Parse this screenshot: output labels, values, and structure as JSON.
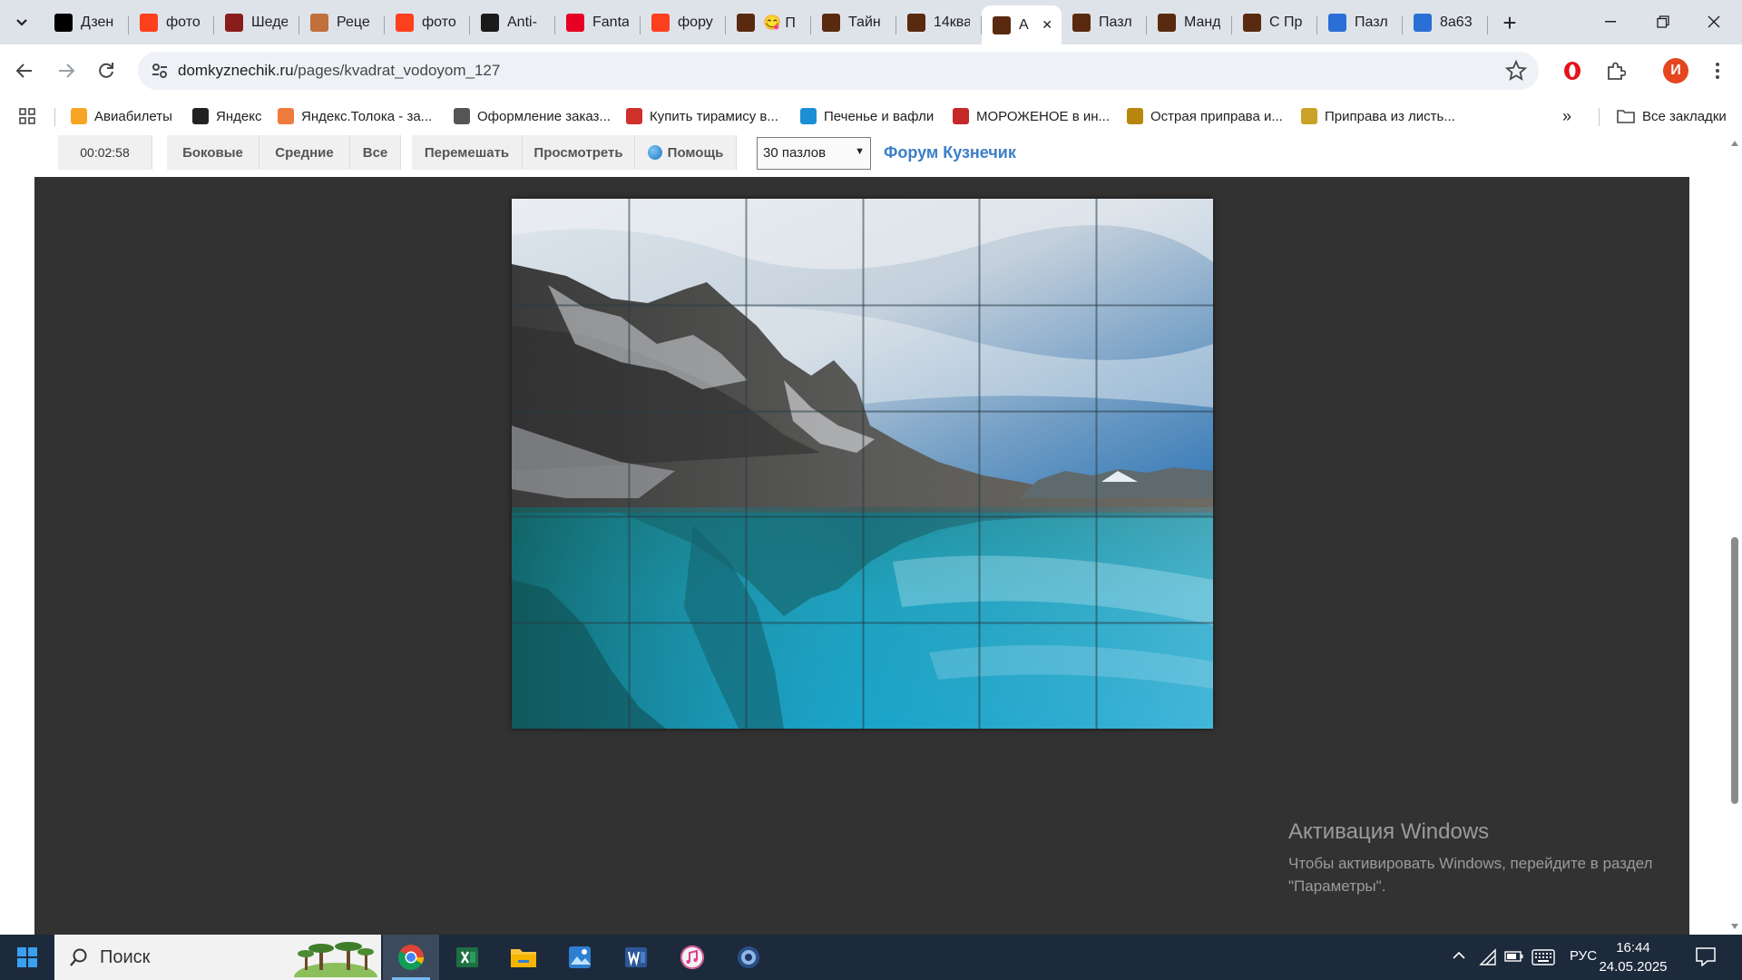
{
  "browser": {
    "tabs": [
      {
        "title": "Дзен",
        "icon": "dzen-icon",
        "color": "#000000"
      },
      {
        "title": "фото",
        "icon": "yandex-icon",
        "color": "#fc3f1d"
      },
      {
        "title": "Шеде",
        "icon": "site-icon",
        "color": "#8b1c1c"
      },
      {
        "title": "Реце",
        "icon": "recipe-icon",
        "color": "#c0703a"
      },
      {
        "title": "фото",
        "icon": "yandex-icon",
        "color": "#fc3f1d"
      },
      {
        "title": "Anti-",
        "icon": "anti-icon",
        "color": "#1a1a1a"
      },
      {
        "title": "Fanta",
        "icon": "pinterest-icon",
        "color": "#e60023"
      },
      {
        "title": "фору",
        "icon": "yandex-icon",
        "color": "#fc3f1d"
      },
      {
        "title": "😋 П",
        "icon": "puzzle-site-icon",
        "color": "#5a2a10"
      },
      {
        "title": "Тайн",
        "icon": "puzzle-site-icon",
        "color": "#5a2a10"
      },
      {
        "title": "14ква",
        "icon": "puzzle-site-icon",
        "color": "#5a2a10"
      },
      {
        "title": "А",
        "icon": "puzzle-site-icon",
        "color": "#5a2a10",
        "active": true
      },
      {
        "title": "Пазл",
        "icon": "puzzle-site-icon",
        "color": "#5a2a10"
      },
      {
        "title": "Манд",
        "icon": "puzzle-site-icon",
        "color": "#5a2a10"
      },
      {
        "title": "С Пр",
        "icon": "puzzle-site-icon",
        "color": "#5a2a10"
      },
      {
        "title": "Пазл",
        "icon": "puzzle-blue-icon",
        "color": "#2a6fd6"
      },
      {
        "title": "8a63",
        "icon": "puzzle-blue-icon",
        "color": "#2a6fd6"
      }
    ],
    "url": {
      "host": "domkyznechik.ru",
      "path": "/pages/kvadrat_vodoyom_127"
    },
    "profile_initial": "И",
    "bookmarks": [
      {
        "label": "Авиабилеты",
        "color": "#f5a623"
      },
      {
        "label": "Яндекс",
        "color": "#222222"
      },
      {
        "label": "Яндекс.Толока - за...",
        "color": "#f07b3f"
      },
      {
        "label": "Оформление заказ...",
        "color": "#555555"
      },
      {
        "label": "Купить тирамису в...",
        "color": "#d0302a"
      },
      {
        "label": "Печенье и вафли",
        "color": "#1b8fd6"
      },
      {
        "label": "МОРОЖЕНОЕ в ин...",
        "color": "#c62828"
      },
      {
        "label": "Острая приправа и...",
        "color": "#b8860b"
      },
      {
        "label": "Приправа из листь...",
        "color": "#c9a227"
      }
    ],
    "all_bookmarks": "Все закладки"
  },
  "puzzle": {
    "timer": "00:02:58",
    "buttons": {
      "sides": "Боковые",
      "middle": "Средние",
      "all": "Все",
      "shuffle": "Перемешать",
      "preview": "Просмотреть",
      "help": "Помощь"
    },
    "pieces_selected": "30 пазлов",
    "forum_link": "Форум Кузнечик",
    "grid_columns": 6,
    "grid_rows": 5
  },
  "windows": {
    "activation_title": "Активация Windows",
    "activation_text": "Чтобы активировать Windows, перейдите в раздел \"Параметры\".",
    "search_placeholder": "Поиск",
    "lang": "РУС",
    "time": "16:44",
    "date": "24.05.2025"
  }
}
